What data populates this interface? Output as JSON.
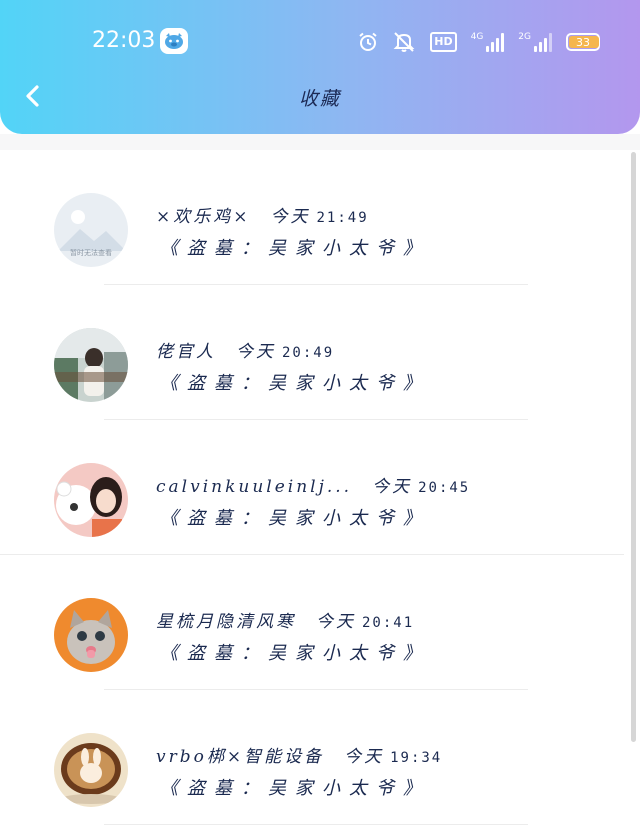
{
  "status_bar": {
    "time": "22:03",
    "app_icon": "pig-app-icon",
    "hd_label": "HD",
    "network1": "4G",
    "network2": "2G",
    "battery": "33",
    "icons": [
      "alarm-icon",
      "mute-icon",
      "hd-icon",
      "signal-4g-icon",
      "signal-2g-icon",
      "battery-icon"
    ]
  },
  "header": {
    "title": "收藏",
    "back_icon": "chevron-left-icon"
  },
  "colors": {
    "gradient_start": "#52d4f7",
    "gradient_end": "#b397ee",
    "text": "#1b2a50",
    "battery": "#f5b64e"
  },
  "favorites": [
    {
      "name": "×欢乐鸡×",
      "date": "今天",
      "time": "21:49",
      "content": "《盗墓：吴家小太爷》",
      "avatar": "placeholder-image"
    },
    {
      "name": "佬官人",
      "date": "今天",
      "time": "20:49",
      "content": "《盗墓：吴家小太爷》",
      "avatar": "photo-girl-street"
    },
    {
      "name": "calvinkuuleinlj...",
      "date": "今天",
      "time": "20:45",
      "content": "《盗墓：吴家小太爷》",
      "avatar": "photo-girl-teddy-bear"
    },
    {
      "name": "星梳月隐清风寒",
      "date": "今天",
      "time": "20:41",
      "content": "《盗墓：吴家小太爷》",
      "avatar": "photo-kitten"
    },
    {
      "name": "vrbo梆×智能设备",
      "date": "今天",
      "time": "19:34",
      "content": "《盗墓：吴家小太爷》",
      "avatar": "photo-latte-art"
    }
  ],
  "avatar_placeholder_text": "暂时无法查看"
}
